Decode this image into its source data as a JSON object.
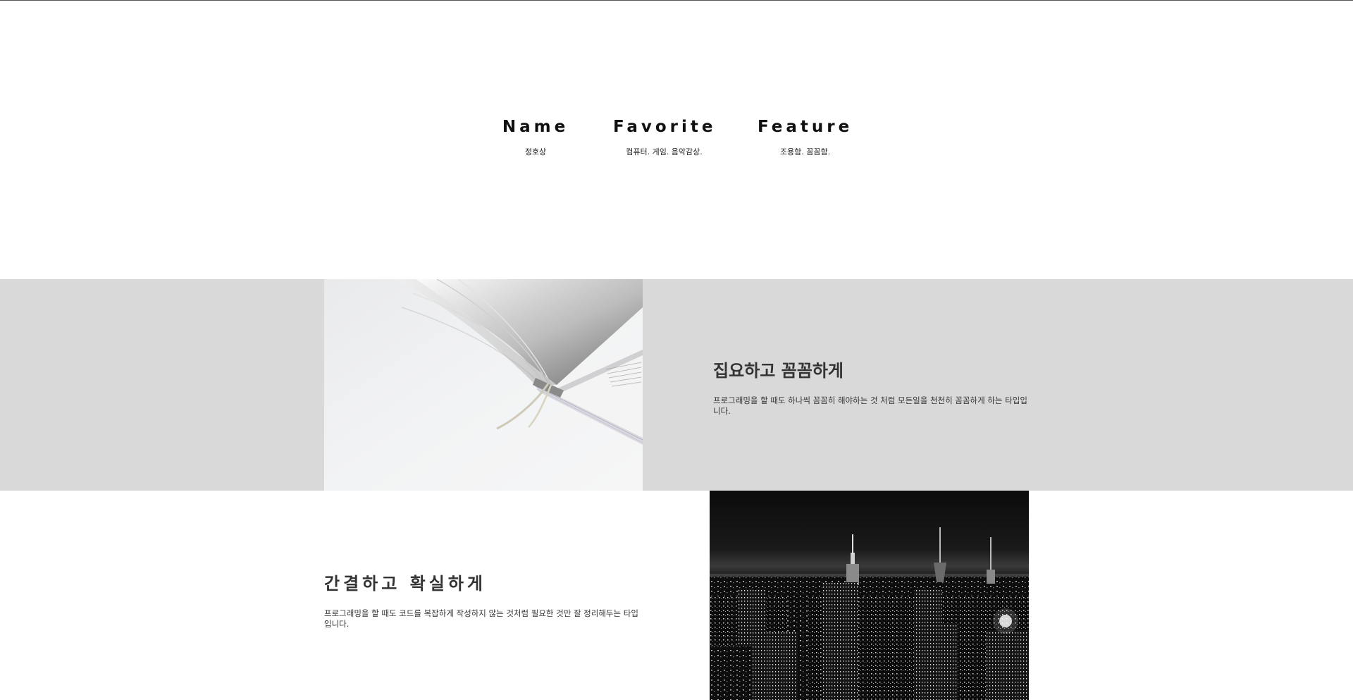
{
  "profile": {
    "columns": [
      {
        "heading": "Name",
        "value": "정호상"
      },
      {
        "heading": "Favorite",
        "value": "컴퓨터. 게임. 음악감상."
      },
      {
        "heading": "Feature",
        "value": "조용함. 꼼꼼함."
      }
    ]
  },
  "feature_1": {
    "title": "집요하고 꼼꼼하게",
    "description": "프로그래밍을 할 때도 하나씩 꼼꼼히 해야하는 것 처럼 모든일을 천천히 꼼꼼하게 하는 타입입니다.",
    "image": "open-book-photo"
  },
  "feature_2": {
    "title": "간결하고 확실하게",
    "description": "프로그래밍을 할 때도 코드를 복잡하게 작성하지 않는 것처럼 필요한 것만 잘 정리해두는 타입입니다.",
    "image": "night-city-skyline-photo"
  },
  "colors": {
    "gray_section": "#d9d9d9",
    "background": "#ffffff",
    "text": "#333333"
  }
}
